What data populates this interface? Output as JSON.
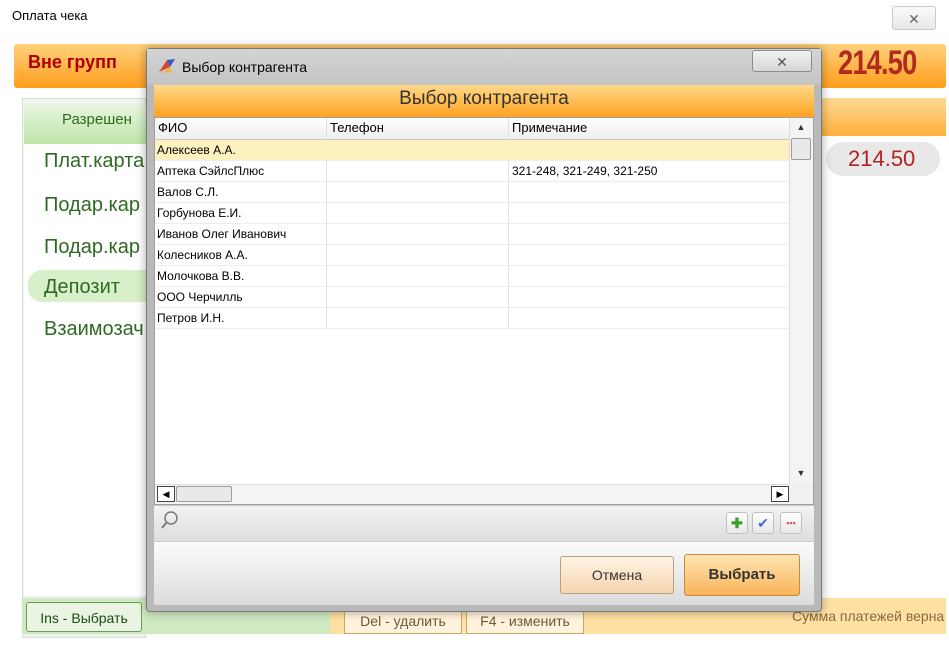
{
  "background": {
    "window_title": "Оплата чека",
    "close_glyph": "✕",
    "header_label": "Вне групп",
    "total": "214.50",
    "allowed_tab": "Разрешен",
    "payment_items": [
      "Плат.карта",
      "Подар.кар",
      "Подар.кар",
      "Депозит",
      "Взаимозач"
    ],
    "amount": "214.50",
    "ins_button": "Ins - Выбрать",
    "del_button": "Del - удалить",
    "f4_button": "F4 - изменить",
    "status": "Сумма платежей верна"
  },
  "dialog": {
    "title": "Выбор контрагента",
    "header_title": "Выбор контрагента",
    "close_glyph": "✕",
    "columns": [
      "ФИО",
      "Телефон",
      "Примечание"
    ],
    "rows": [
      {
        "name": "Алексеев А.А.",
        "phone": "",
        "note": "",
        "selected": true
      },
      {
        "name": "Аптека СэйлсПлюс",
        "phone": "",
        "note": "321-248, 321-249, 321-250",
        "selected": false
      },
      {
        "name": "Валов С.Л.",
        "phone": "",
        "note": "",
        "selected": false
      },
      {
        "name": "Горбунова Е.И.",
        "phone": "",
        "note": "",
        "selected": false
      },
      {
        "name": "Иванов Олег Иванович",
        "phone": "",
        "note": "",
        "selected": false
      },
      {
        "name": "Колесников А.А.",
        "phone": "",
        "note": "",
        "selected": false
      },
      {
        "name": "Молочкова В.В.",
        "phone": "",
        "note": "",
        "selected": false
      },
      {
        "name": "ООО Черчилль",
        "phone": "",
        "note": "",
        "selected": false
      },
      {
        "name": "Петров И.Н.",
        "phone": "",
        "note": "",
        "selected": false
      }
    ],
    "cancel_button": "Отмена",
    "select_button": "Выбрать",
    "icons": {
      "search": "search-icon",
      "add": "plus-icon",
      "confirm": "check-icon",
      "delete": "dots-icon"
    }
  },
  "colors": {
    "accent_orange": "#ffa21f",
    "total_red": "#b22a1d",
    "green_text": "#2e6a23",
    "selected_row": "#fdf2bf"
  }
}
